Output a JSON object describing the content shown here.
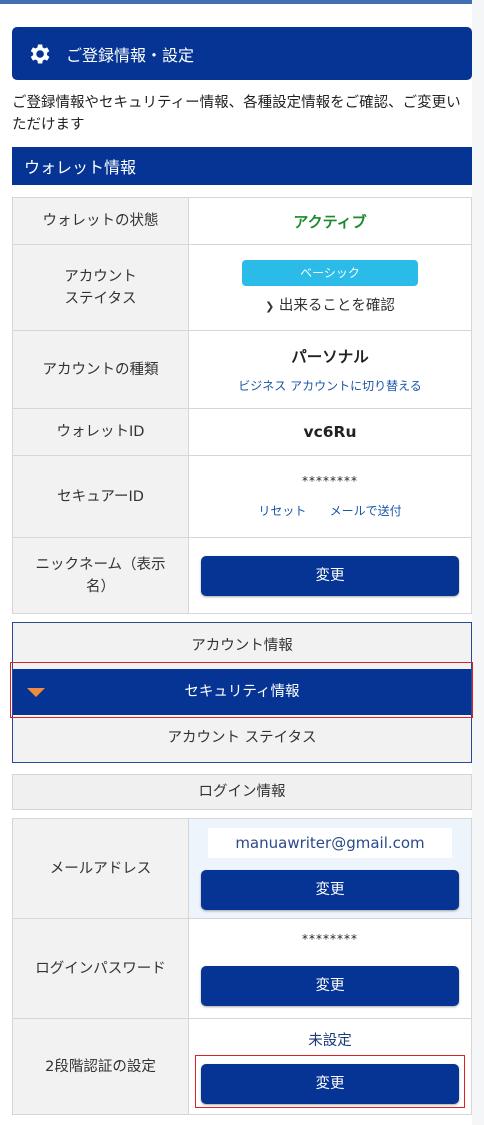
{
  "header": {
    "title": "ご登録情報・設定",
    "icon": "gear-icon"
  },
  "description": "ご登録情報やセキュリティー情報、各種設定情報をご確認、ご変更いただけます",
  "wallet_section": {
    "title": "ウォレット情報",
    "rows": {
      "state_label": "ウォレットの状態",
      "state_value": "アクティブ",
      "status_label_1": "アカウント",
      "status_label_2": "ステイタス",
      "status_badge": "ベーシック",
      "status_confirm": "出来ることを確認",
      "type_label": "アカウントの種類",
      "type_value": "パーソナル",
      "type_switch_link": "ビジネス アカウントに切り替える",
      "wallet_id_label": "ウォレットID",
      "wallet_id_value": "vc6Ru",
      "secure_id_label": "セキュアーID",
      "secure_id_value": "********",
      "secure_reset_link": "リセット",
      "secure_mail_link": "メールで送付",
      "nickname_label_1": "ニックネーム（表示",
      "nickname_label_2": "名）",
      "nickname_button": "変更"
    }
  },
  "menu": {
    "items": [
      "アカウント情報",
      "セキュリティ情報",
      "アカウント ステイタス"
    ],
    "active_index": 1
  },
  "login_section": {
    "title": "ログイン情報",
    "email_label": "メールアドレス",
    "email_value": "manuawriter@gmail.com",
    "email_button": "変更",
    "password_label": "ログインパスワード",
    "password_value": "********",
    "password_button": "変更",
    "twofa_label": "2段階認証の設定",
    "twofa_value": "未設定",
    "twofa_button": "変更"
  },
  "colors": {
    "primary": "#063494",
    "badge": "#2bbbe8",
    "active_green": "#1d8a2c",
    "highlight_red": "#e02020",
    "triangle": "#f08c3c"
  }
}
